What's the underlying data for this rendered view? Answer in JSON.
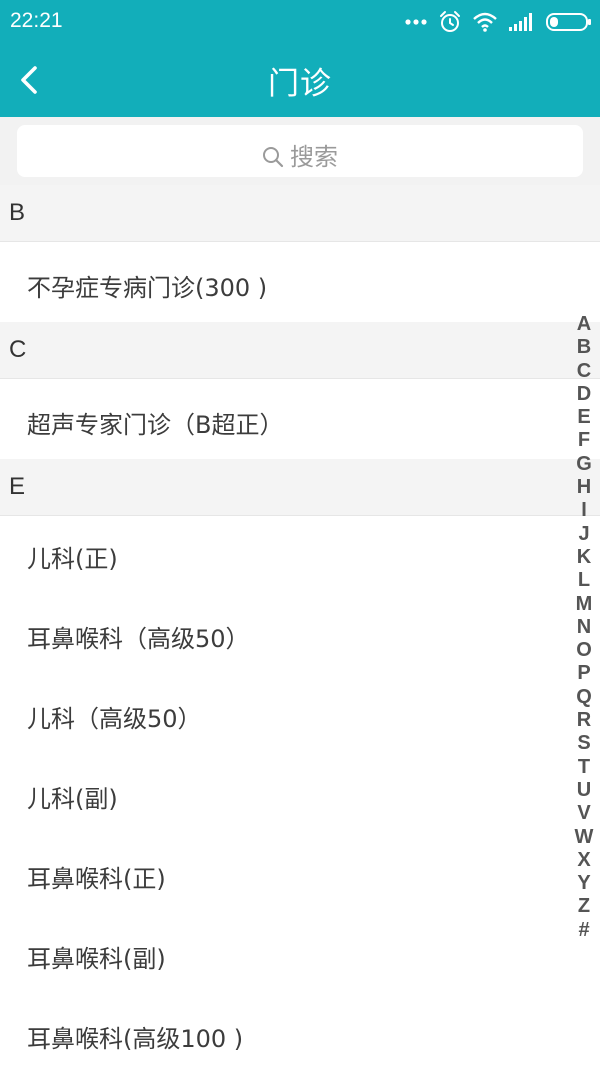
{
  "status_bar": {
    "time": "22:21",
    "icons": [
      "more-dots-icon",
      "alarm-icon",
      "wifi-icon",
      "signal-icon",
      "battery-icon"
    ]
  },
  "header": {
    "title": "门诊",
    "back_icon": "chevron-left-icon",
    "background_color": "#12AEBA"
  },
  "search": {
    "placeholder": "搜索",
    "icon": "search-icon"
  },
  "sections": [
    {
      "letter": "B",
      "items": [
        "不孕症专病门诊(300 )"
      ]
    },
    {
      "letter": "C",
      "items": [
        "超声专家门诊（B超正）"
      ]
    },
    {
      "letter": "E",
      "items": [
        "儿科(正)",
        "耳鼻喉科（高级50）",
        "儿科（高级50）",
        "儿科(副)",
        "耳鼻喉科(正)",
        "耳鼻喉科(副)",
        "耳鼻喉科(高级100 )"
      ]
    }
  ],
  "alpha_index": [
    "A",
    "B",
    "C",
    "D",
    "E",
    "F",
    "G",
    "H",
    "I",
    "J",
    "K",
    "L",
    "M",
    "N",
    "O",
    "P",
    "Q",
    "R",
    "S",
    "T",
    "U",
    "V",
    "W",
    "X",
    "Y",
    "Z",
    "#"
  ]
}
